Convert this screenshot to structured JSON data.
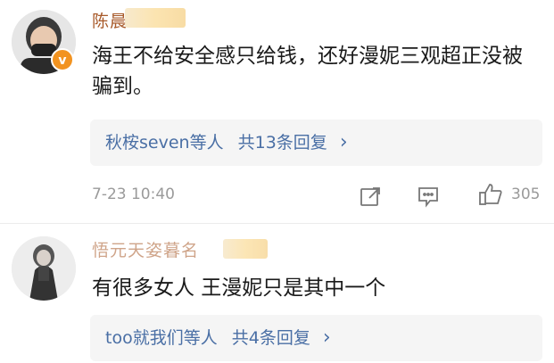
{
  "comments": [
    {
      "author": "陈晨",
      "text": "海王不给安全感只给钱，还好漫妮三观超正没被骗到。",
      "replies": {
        "users": "秋桉seven等人",
        "count_label": "共13条回复",
        "chevron": "›"
      },
      "timestamp": "7-23 10:40",
      "likes": "305"
    },
    {
      "author": "悟元天姿暮名",
      "text": "有很多女人 王漫妮只是其中一个",
      "replies": {
        "users": "too就我们等人",
        "count_label": "共4条回复",
        "chevron": "›"
      }
    }
  ],
  "colors": {
    "author_name": "#a85a2a",
    "reply_link": "#4a6fa5",
    "verified_badge": "#f29320"
  }
}
